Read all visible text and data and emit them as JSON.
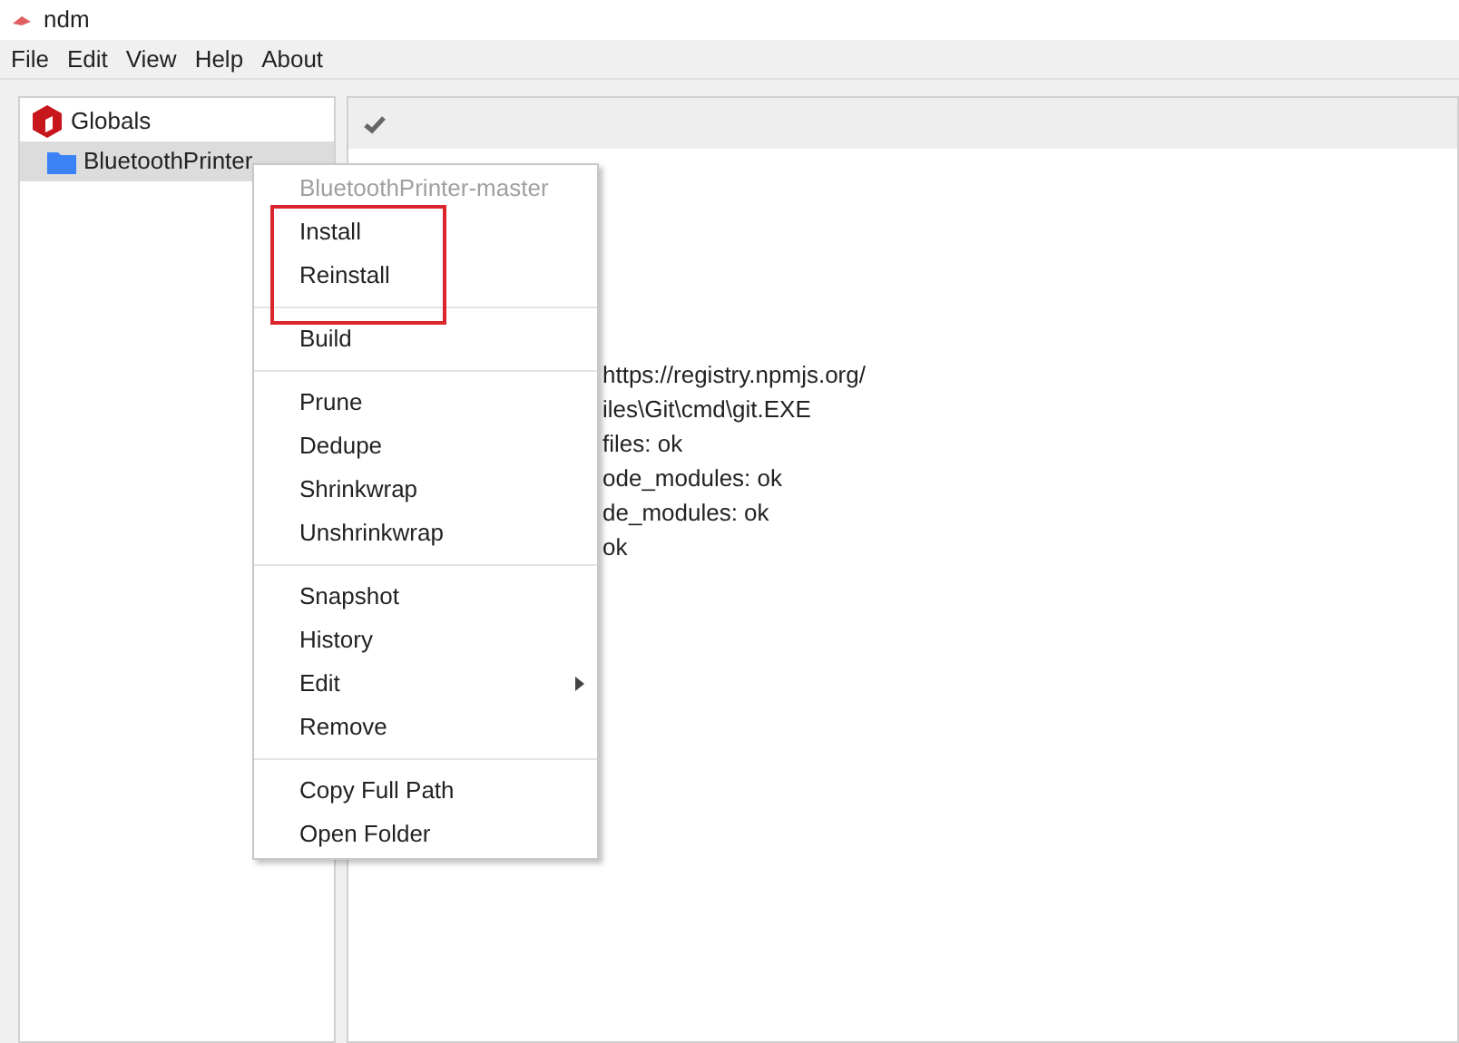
{
  "window": {
    "title": "ndm"
  },
  "menubar": [
    "File",
    "Edit",
    "View",
    "Help",
    "About"
  ],
  "sidebar": {
    "items": [
      {
        "label": "Globals",
        "kind": "globals",
        "selected": false
      },
      {
        "label": "BluetoothPrinter",
        "kind": "folder",
        "selected": true
      }
    ]
  },
  "output": {
    "lines": [
      "https://registry.npmjs.org/",
      "iles\\Git\\cmd\\git.EXE",
      "files: ok",
      "ode_modules: ok",
      "de_modules: ok",
      "ok"
    ]
  },
  "context_menu": {
    "header": "BluetoothPrinter-master",
    "sections": [
      {
        "highlighted": true,
        "items": [
          {
            "label": "Install",
            "submenu": false
          },
          {
            "label": "Reinstall",
            "submenu": false
          }
        ]
      },
      {
        "highlighted": false,
        "items": [
          {
            "label": "Build",
            "submenu": false
          }
        ]
      },
      {
        "highlighted": false,
        "items": [
          {
            "label": "Prune",
            "submenu": false
          },
          {
            "label": "Dedupe",
            "submenu": false
          },
          {
            "label": "Shrinkwrap",
            "submenu": false
          },
          {
            "label": "Unshrinkwrap",
            "submenu": false
          }
        ]
      },
      {
        "highlighted": false,
        "items": [
          {
            "label": "Snapshot",
            "submenu": false
          },
          {
            "label": "History",
            "submenu": false
          },
          {
            "label": "Edit",
            "submenu": true
          },
          {
            "label": "Remove",
            "submenu": false
          }
        ]
      },
      {
        "highlighted": false,
        "items": [
          {
            "label": "Copy Full Path",
            "submenu": false
          },
          {
            "label": "Open Folder",
            "submenu": false
          }
        ]
      }
    ]
  }
}
